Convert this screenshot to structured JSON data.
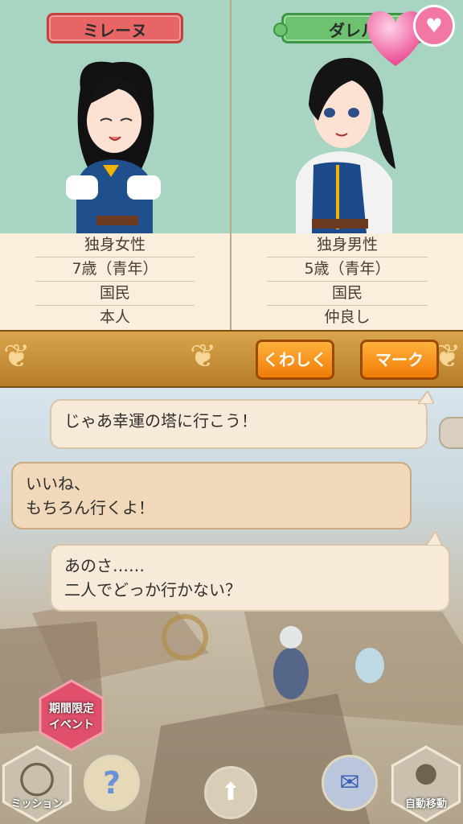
{
  "left_profile": {
    "name": "ミレーヌ",
    "attributes": [
      "独身女性",
      "7歳（青年）",
      "国民",
      "本人"
    ]
  },
  "right_profile": {
    "name": "ダレル",
    "attributes": [
      "独身男性",
      "5歳（青年）",
      "国民",
      "仲良し"
    ]
  },
  "actions": {
    "details_label": "くわしく",
    "mark_label": "マーク"
  },
  "heart_icon": "heart-icon",
  "dialogue": [
    {
      "text_lines": [
        "じゃあ幸運の塔に行こう！"
      ]
    },
    {
      "text_lines": [
        "いいね、",
        "もちろん行くよ！"
      ]
    },
    {
      "text_lines": [
        "あのさ……",
        "二人でどっか行かない？"
      ]
    }
  ],
  "bottom_menu": {
    "event_label_1": "期間限定",
    "event_label_2": "イベント",
    "mission_label": "ミッション",
    "auto_move_label": "自動移動"
  },
  "colors": {
    "panel_bg": "#a8d5c2",
    "name_tag_red": "#e86565",
    "name_tag_green": "#6cc26f",
    "accent_orange": "#f59a1e"
  }
}
